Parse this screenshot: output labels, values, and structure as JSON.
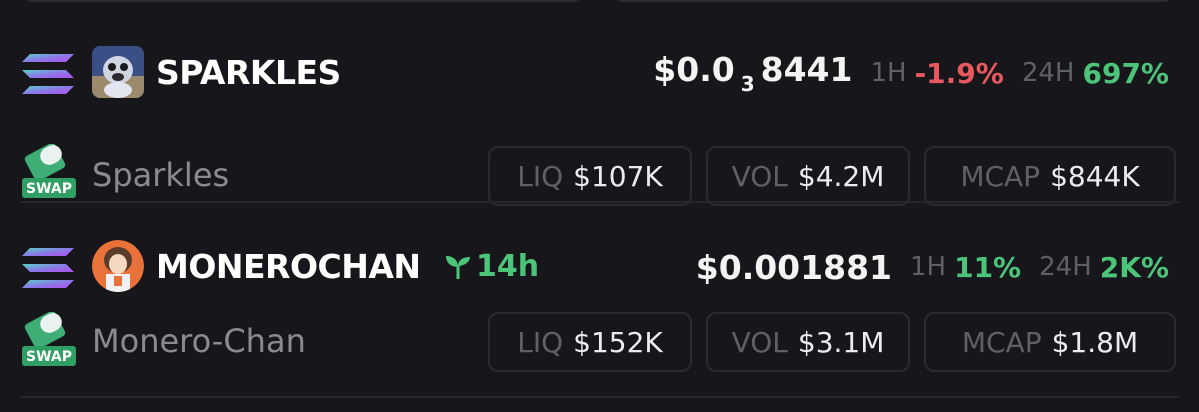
{
  "tokens": [
    {
      "symbol": "SPARKLES",
      "name": "Sparkles",
      "price_prefix": "$0.0",
      "price_subscript": "3",
      "price_suffix": "8441",
      "age": "",
      "change_1h_label": "1H",
      "change_1h": "-1.9%",
      "change_24h_label": "24H",
      "change_24h": "697%",
      "liq_label": "LIQ",
      "liq": "$107K",
      "vol_label": "VOL",
      "vol": "$4.2M",
      "mcap_label": "MCAP",
      "mcap": "$844K",
      "chain_icon": "solana-icon",
      "dex_icon": "swap-icon",
      "avatar": "sparkles-avatar"
    },
    {
      "symbol": "MONEROCHAN",
      "name": "Monero-Chan",
      "price_prefix": "$0.001881",
      "price_subscript": "",
      "price_suffix": "",
      "age": "14h",
      "change_1h_label": "1H",
      "change_1h": "11%",
      "change_24h_label": "24H",
      "change_24h": "2K%",
      "liq_label": "LIQ",
      "liq": "$152K",
      "vol_label": "VOL",
      "vol": "$3.1M",
      "mcap_label": "MCAP",
      "mcap": "$1.8M",
      "chain_icon": "solana-icon",
      "dex_icon": "swap-icon",
      "avatar": "monerochan-avatar"
    }
  ],
  "dex_badge_text": "SWAP",
  "colors": {
    "background": "#17171b",
    "positive": "#4cc47a",
    "negative": "#e8595f",
    "muted": "#5f6067",
    "border": "#2a2b31"
  }
}
